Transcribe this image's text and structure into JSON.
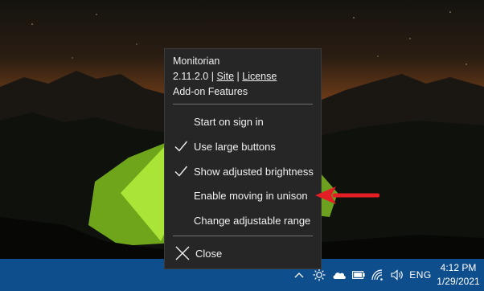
{
  "colors": {
    "taskbar": "#0f4e8c",
    "menu_bg": "#262626",
    "menu_text": "#f0f0f0",
    "separator": "#6f6f6f",
    "annotation_arrow": "#e31e24",
    "tent": "#9bdc2c"
  },
  "menu": {
    "app_name": "Monitorian",
    "version": "2.11.2.0",
    "link_separator": "|",
    "site_link": "Site",
    "license_link": "License",
    "addon_features": "Add-on Features",
    "items": [
      {
        "label": "Start on sign in",
        "checked": false,
        "icon": null
      },
      {
        "label": "Use large buttons",
        "checked": true,
        "icon": "checkmark-icon"
      },
      {
        "label": "Show adjusted brightness",
        "checked": true,
        "icon": "checkmark-icon"
      },
      {
        "label": "Enable moving in unison",
        "checked": false,
        "icon": null
      },
      {
        "label": "Change adjustable range",
        "checked": false,
        "icon": null
      }
    ],
    "close_label": "Close",
    "close_icon": "close-icon"
  },
  "taskbar": {
    "tray_icons": [
      "chevron-up-icon",
      "monitorian-brightness-icon",
      "onedrive-cloud-icon",
      "battery-icon",
      "wifi-icon",
      "volume-icon"
    ],
    "language": "ENG",
    "time": "4:12 PM",
    "date": "1/29/2021"
  },
  "annotation": {
    "type": "arrow",
    "points_to": "Enable moving in unison"
  }
}
